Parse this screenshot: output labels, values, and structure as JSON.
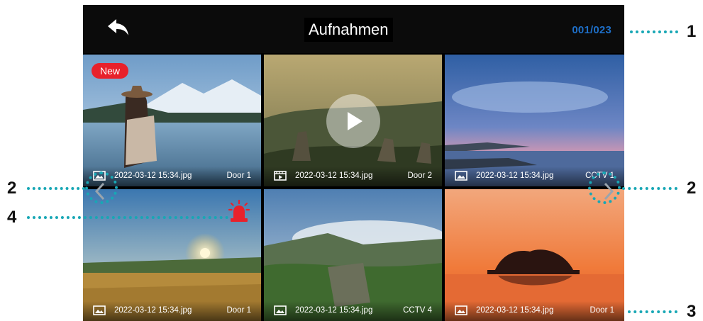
{
  "header": {
    "title": "Aufnahmen",
    "counter": "001/023",
    "back_icon": "back-arrow-icon"
  },
  "badges": {
    "new": "New"
  },
  "recordings": [
    {
      "file": "2022-03-12 15:34.jpg",
      "source": "Door 1",
      "type": "photo",
      "new": true
    },
    {
      "file": "2022-03-12 15:34.jpg",
      "source": "Door 2",
      "type": "video"
    },
    {
      "file": "2022-03-12 15:34.jpg",
      "source": "CCTV 1",
      "type": "photo"
    },
    {
      "file": "2022-03-12 15:34.jpg",
      "source": "Door 1",
      "type": "photo",
      "alarm": true
    },
    {
      "file": "2022-03-12 15:34.jpg",
      "source": "CCTV 4",
      "type": "photo"
    },
    {
      "file": "2022-03-12 15:34.jpg",
      "source": "Door 1",
      "type": "photo"
    }
  ],
  "navigation": {
    "prev_icon": "chevron-left-icon",
    "next_icon": "chevron-right-icon"
  },
  "callouts": {
    "counter": "1",
    "prev": "2",
    "next": "2",
    "info_bar": "3",
    "alarm": "4"
  },
  "colors": {
    "counter": "#1e6fc8",
    "new_badge": "#e8212b",
    "alarm": "#e8212b",
    "callout": "#18a7b5"
  }
}
